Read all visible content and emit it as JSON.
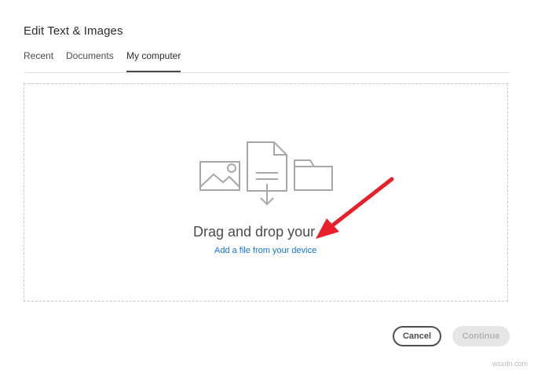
{
  "dialog": {
    "title": "Edit Text & Images"
  },
  "tabs": [
    {
      "label": "Recent"
    },
    {
      "label": "Documents"
    },
    {
      "label": "My computer"
    }
  ],
  "dropzone": {
    "instruction": "Drag and drop your",
    "link_label": "Add a file from your device",
    "icons": [
      "image-icon",
      "document-download-icon",
      "folder-icon"
    ]
  },
  "annotation": {
    "icon": "red-arrow-icon",
    "color": "#e8202a"
  },
  "footer": {
    "cancel_label": "Cancel",
    "continue_label": "Continue"
  },
  "watermark": "wsxdn.com",
  "colors": {
    "link": "#1473e6",
    "icon_stroke": "#a8a8a8",
    "disabled_bg": "#e6e6e6"
  }
}
